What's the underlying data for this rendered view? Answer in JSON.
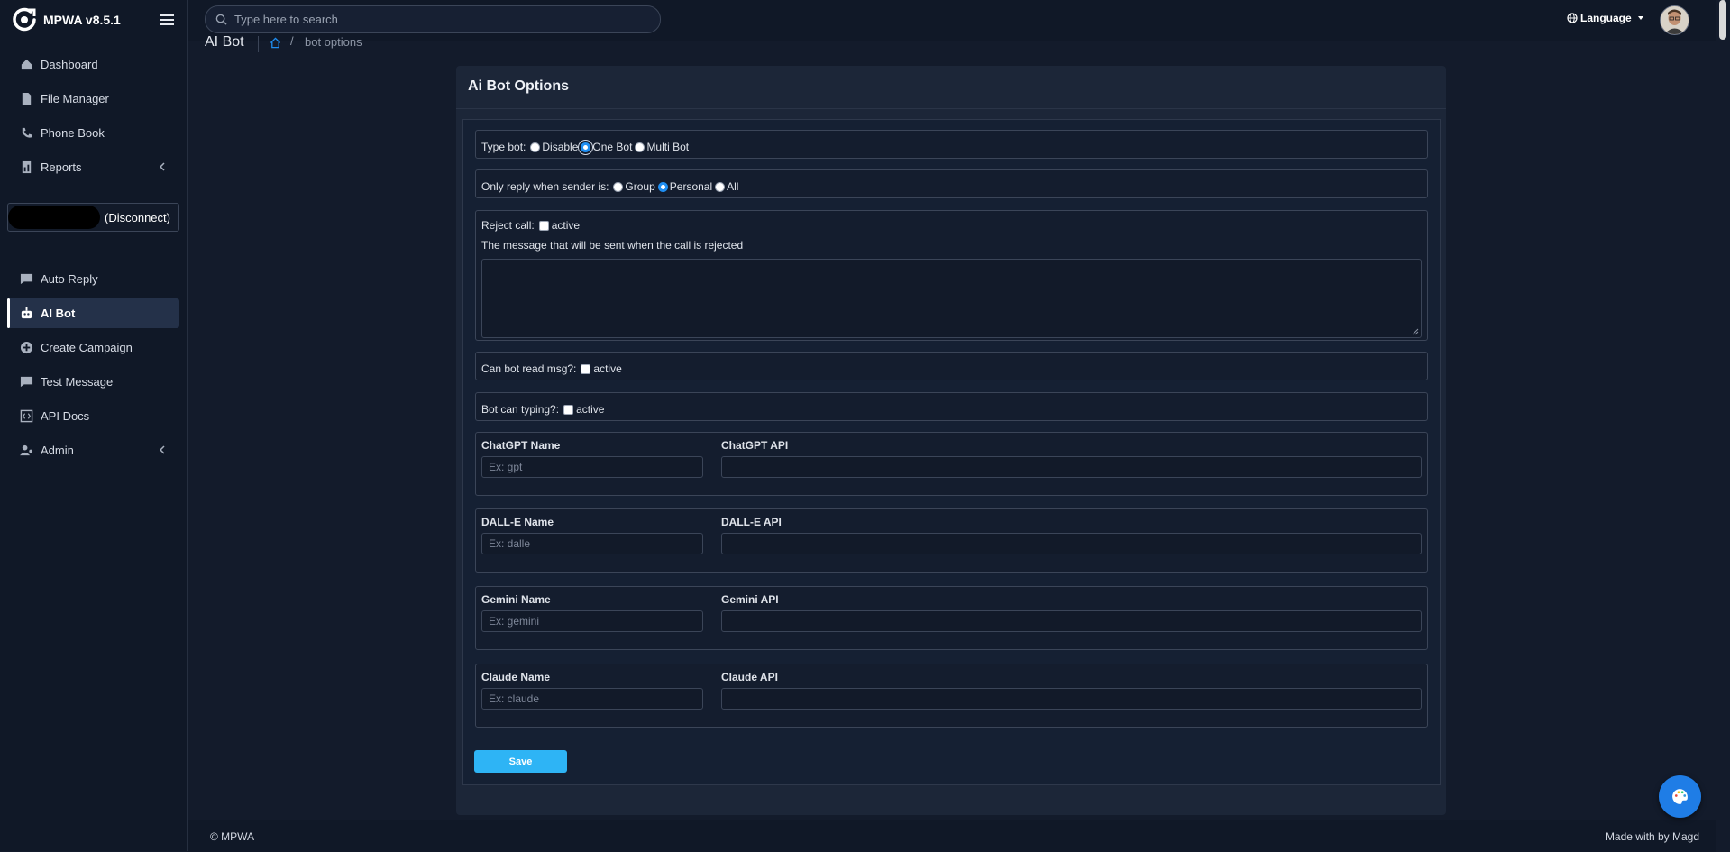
{
  "app": {
    "name": "MPWA v8.5.1"
  },
  "sidebar": {
    "items": [
      {
        "label": "Dashboard",
        "icon": "home-icon"
      },
      {
        "label": "File Manager",
        "icon": "file-icon"
      },
      {
        "label": "Phone Book",
        "icon": "phone-icon"
      },
      {
        "label": "Reports",
        "icon": "report-icon"
      }
    ],
    "device": {
      "status": "(Disconnect)"
    },
    "items2": [
      {
        "label": "Auto Reply",
        "icon": "chat-icon"
      },
      {
        "label": "AI Bot",
        "icon": "robot-icon",
        "active": true
      },
      {
        "label": "Create Campaign",
        "icon": "plus-circle-icon"
      },
      {
        "label": "Test Message",
        "icon": "message-icon"
      },
      {
        "label": "API Docs",
        "icon": "code-icon"
      },
      {
        "label": "Admin",
        "icon": "user-cog-icon"
      }
    ]
  },
  "topbar": {
    "search_placeholder": "Type here to search",
    "language": "Language"
  },
  "breadcrumb": {
    "title": "AI Bot",
    "current": "bot options"
  },
  "card": {
    "title": "Ai Bot Options",
    "type_bot": {
      "label": "Type bot:",
      "options": [
        "Disable",
        "One Bot",
        "Multi Bot"
      ],
      "selected": "One Bot"
    },
    "reply_when": {
      "label": "Only reply when sender is:",
      "options": [
        "Group",
        "Personal",
        "All"
      ],
      "selected": "Personal"
    },
    "reject_call": {
      "label": "Reject call:",
      "checkbox_label": "active",
      "message_label": "The message that will be sent when the call is rejected",
      "message": ""
    },
    "read_msg": {
      "label": "Can bot read msg?:",
      "checkbox_label": "active"
    },
    "typing": {
      "label": "Bot can typing?:",
      "checkbox_label": "active"
    },
    "providers": [
      {
        "name_label": "ChatGPT Name",
        "name_placeholder": "Ex: gpt",
        "api_label": "ChatGPT API"
      },
      {
        "name_label": "DALL-E Name",
        "name_placeholder": "Ex: dalle",
        "api_label": "DALL-E API"
      },
      {
        "name_label": "Gemini Name",
        "name_placeholder": "Ex: gemini",
        "api_label": "Gemini API"
      },
      {
        "name_label": "Claude Name",
        "name_placeholder": "Ex: claude",
        "api_label": "Claude API"
      }
    ],
    "save_label": "Save"
  },
  "footer": {
    "copyright": "© MPWA",
    "made_by": "Made with by Magd"
  },
  "colors": {
    "background": "#131b2b",
    "sidebar": "#101827",
    "card": "#1c2638",
    "accent": "#1f8ef1",
    "save": "#2eb4f5"
  }
}
